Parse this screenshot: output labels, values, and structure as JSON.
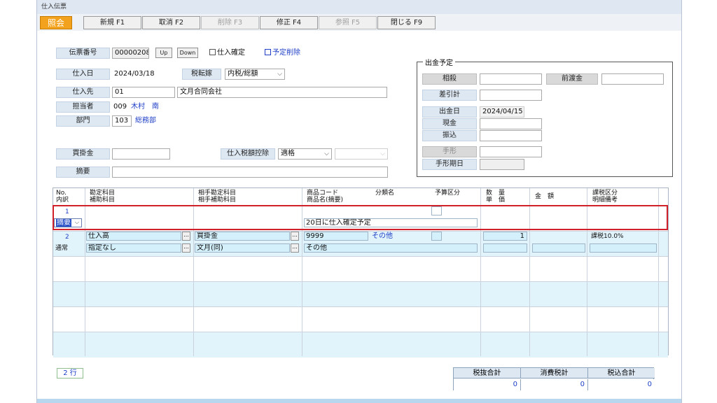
{
  "window": {
    "title": "仕入伝票"
  },
  "toolbar": {
    "mode": "照会",
    "buttons": [
      "新規 F1",
      "取消 F2",
      "削除 F3",
      "修正 F4",
      "参照 F5",
      "閉じる F9"
    ]
  },
  "form": {
    "slip_no_label": "伝票番号",
    "slip_no": "00000208",
    "up": "Up",
    "down": "Down",
    "confirm_label": "仕入確定",
    "plan_delete_label": "予定削除",
    "date_label": "仕入日",
    "date": "2024/03/18",
    "tax_label": "税転嫁",
    "tax_value": "内税/総額",
    "supplier_label": "仕入先",
    "supplier_code": "01",
    "supplier_name": "文月合同会社",
    "staff_label": "担当者",
    "staff_code": "009",
    "staff_name": "木村　南",
    "dept_label": "部門",
    "dept_code": "103",
    "dept_name": "総務部",
    "payable_label": "買掛金",
    "deduct_label": "仕入税額控除",
    "deduct_value": "適格",
    "memo_label": "摘要"
  },
  "payment": {
    "title": "出金予定",
    "offset_label": "相殺",
    "advance_label": "前渡金",
    "balance_label": "差引計",
    "pay_date_label": "出金日",
    "pay_date": "2024/04/15",
    "cash_label": "現金",
    "transfer_label": "振込",
    "bill_label": "手形",
    "bill_due_label": "手形期日"
  },
  "grid": {
    "headers": {
      "no": "No.",
      "breakdown": "内訳",
      "account": "勘定科目",
      "sub_account": "補助科目",
      "counter_account": "相手勘定科目",
      "counter_sub": "相手補助科目",
      "product_code": "商品コード",
      "product_name": "商品名(摘要)",
      "category": "分類名",
      "budget": "予算区分",
      "qty": "数　量",
      "price": "単　価",
      "amount": "金　額",
      "tax_class": "課税区分",
      "detail_note": "明細備考"
    },
    "row1": {
      "no": "1",
      "type": "摘要",
      "memo": "20日に仕入確定予定"
    },
    "row2": {
      "no": "2",
      "type": "通常",
      "account": "仕入高",
      "sub_account": "指定なし",
      "counter_account": "買掛金",
      "counter_sub": "文月(同)",
      "code": "9999",
      "category": "その他",
      "name": "その他",
      "qty": "1",
      "tax": "課税10.0%"
    }
  },
  "footer": {
    "row_count": "2 行",
    "totals": [
      {
        "label": "税抜合計",
        "value": "0"
      },
      {
        "label": "消費税計",
        "value": "0"
      },
      {
        "label": "税込合計",
        "value": "0"
      }
    ]
  }
}
